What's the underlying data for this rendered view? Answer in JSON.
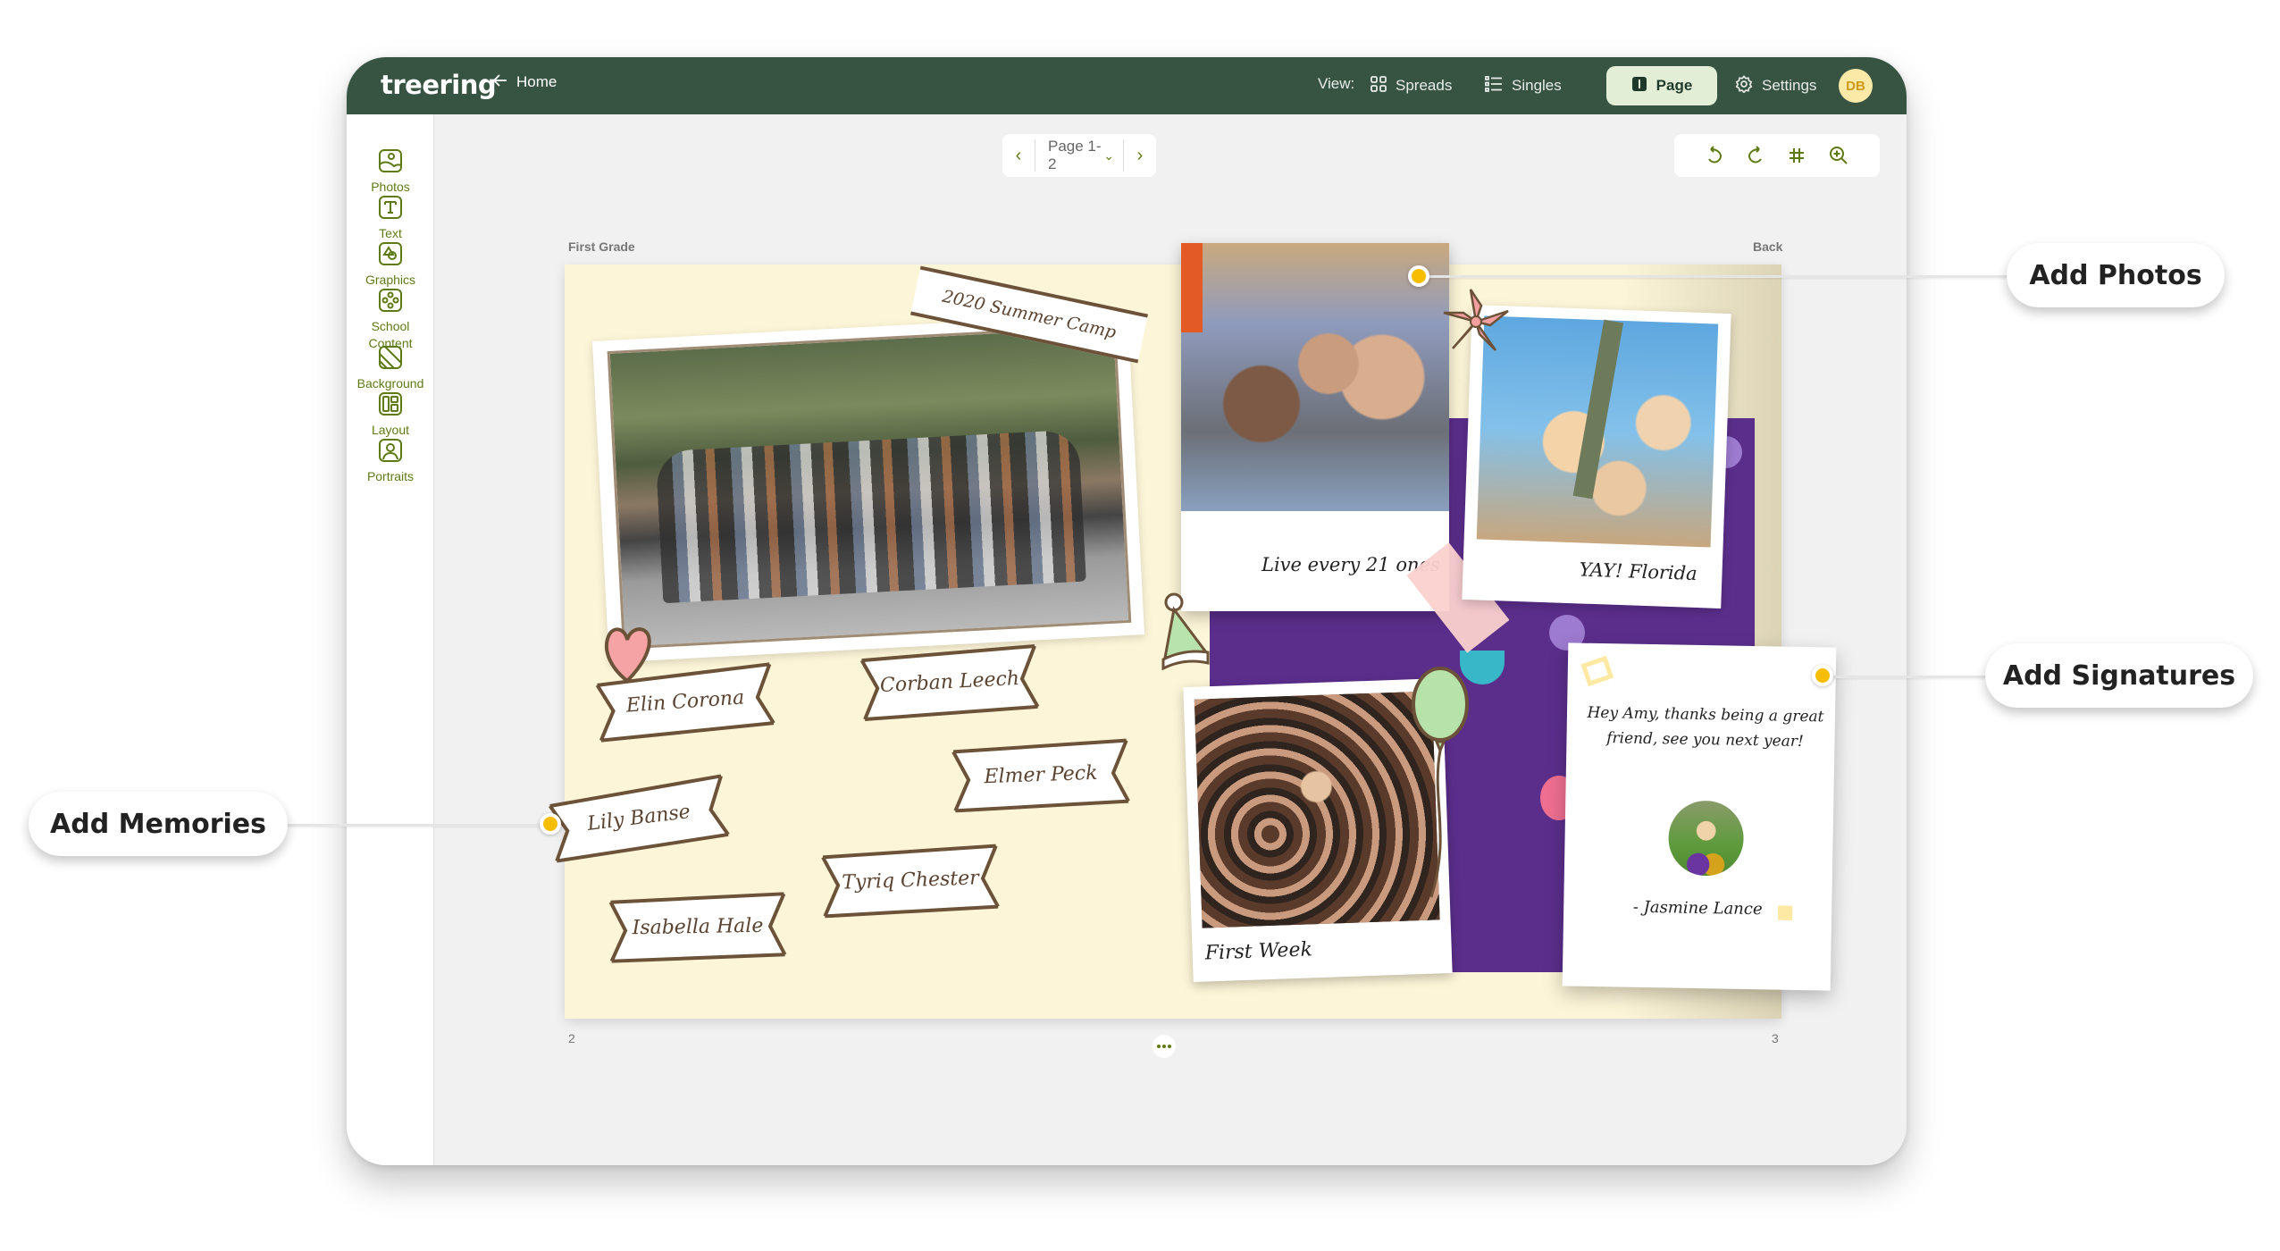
{
  "app": {
    "logo": "treering",
    "home_label": "Home",
    "view_label": "View:",
    "view_options": [
      {
        "label": "Spreads",
        "icon": "grid-icon",
        "active": false
      },
      {
        "label": "Singles",
        "icon": "list-icon",
        "active": false
      },
      {
        "label": "Page",
        "icon": "page-icon",
        "active": true
      }
    ],
    "settings_label": "Settings",
    "avatar_initials": "DB"
  },
  "sidebar": {
    "items": [
      {
        "label": "Photos",
        "icon": "photo-icon"
      },
      {
        "label": "Text",
        "icon": "text-icon"
      },
      {
        "label": "Graphics",
        "icon": "graphics-icon"
      },
      {
        "label": "School Content",
        "icon": "school-content-icon"
      },
      {
        "label": "Background",
        "icon": "background-icon"
      },
      {
        "label": "Layout",
        "icon": "layout-icon"
      },
      {
        "label": "Portraits",
        "icon": "portraits-icon"
      }
    ]
  },
  "pager": {
    "current": "Page 1-2"
  },
  "toolbar": {
    "tools": [
      "undo-icon",
      "redo-icon",
      "grid-guides-icon",
      "zoom-in-icon"
    ]
  },
  "spread": {
    "left_label": "First Grade",
    "right_label": "Back",
    "left_page_number": "2",
    "right_page_number": "3",
    "banner_title": "2020 Summer Camp",
    "names": [
      "Elin Corona",
      "Corban Leech",
      "Lily Banse",
      "Elmer Peck",
      "Tyriq Chester",
      "Isabella Hale"
    ],
    "captions": {
      "selfie": "Live every 21 ones",
      "florida": "YAY! Florida",
      "crowd": "First Week"
    },
    "signature": {
      "message": "Hey Amy, thanks being a great friend, see you next year!",
      "signer": "- Jasmine Lance"
    }
  },
  "callouts": {
    "photos": "Add Photos",
    "signatures": "Add Signatures",
    "memories": "Add Memories"
  },
  "colors": {
    "topbar": "#375443",
    "accent": "#5e7a14",
    "active_view_bg": "#e2eed6",
    "page_bg": "#fdf5d7",
    "purple": "#5b2e8c",
    "hotspot": "#f7bd00"
  }
}
